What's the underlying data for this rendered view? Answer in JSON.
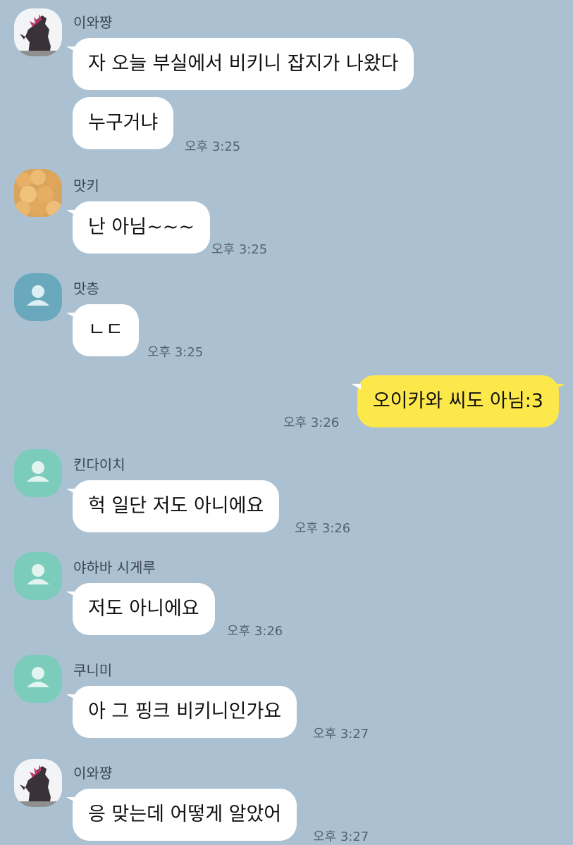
{
  "colors": {
    "background": "#abc1d1",
    "bubble_other": "#ffffff",
    "bubble_mine": "#fde84b",
    "avatar_default_blue": "#6aa9bd",
    "avatar_default_teal": "#7cccbb"
  },
  "messages": [
    {
      "sender": "이와쨩",
      "avatar": "godzilla-icon",
      "text": "자 오늘 부실에서 비키니 잡지가 나왔다",
      "time": ""
    },
    {
      "sender": "",
      "avatar": "",
      "text": "누구거냐",
      "time": "오후 3:25"
    },
    {
      "sender": "맛키",
      "avatar": "cream-puffs-icon",
      "text": "난 아님~~~",
      "time": "오후 3:25"
    },
    {
      "sender": "맛층",
      "avatar": "person-icon",
      "text": "ㄴㄷ",
      "time": "오후 3:25"
    },
    {
      "sender": "me",
      "avatar": "",
      "text": "오이카와 씨도 아님:3",
      "time": "오후 3:26"
    },
    {
      "sender": "킨다이치",
      "avatar": "person-icon",
      "text": "헉 일단 저도 아니에요",
      "time": "오후 3:26"
    },
    {
      "sender": "야하바 시게루",
      "avatar": "person-icon",
      "text": "저도 아니에요",
      "time": "오후 3:26"
    },
    {
      "sender": "쿠니미",
      "avatar": "person-icon",
      "text": "아 그 핑크 비키니인가요",
      "time": "오후 3:27"
    },
    {
      "sender": "이와쨩",
      "avatar": "godzilla-icon",
      "text": "응 맞는데 어떻게 알았어",
      "time": "오후 3:27"
    }
  ]
}
